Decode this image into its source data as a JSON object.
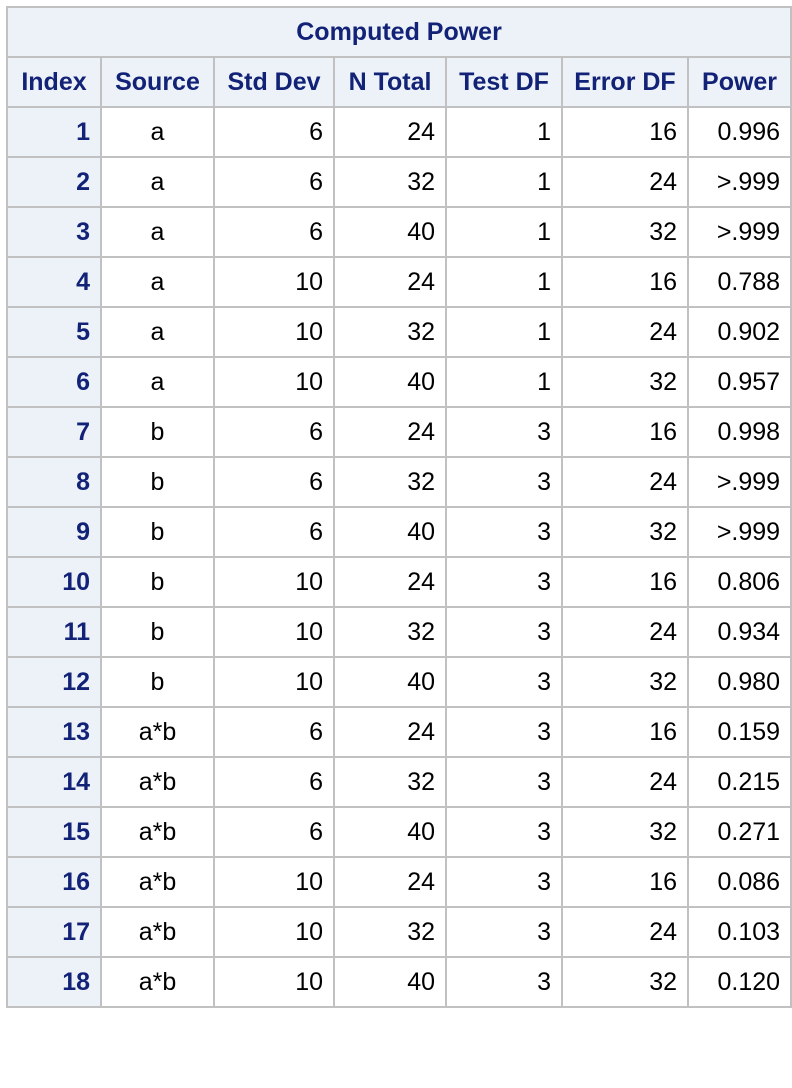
{
  "table": {
    "title": "Computed Power",
    "columns": [
      "Index",
      "Source",
      "Std Dev",
      "N Total",
      "Test DF",
      "Error DF",
      "Power"
    ],
    "rows": [
      [
        "1",
        "a",
        "6",
        "24",
        "1",
        "16",
        "0.996"
      ],
      [
        "2",
        "a",
        "6",
        "32",
        "1",
        "24",
        ">.999"
      ],
      [
        "3",
        "a",
        "6",
        "40",
        "1",
        "32",
        ">.999"
      ],
      [
        "4",
        "a",
        "10",
        "24",
        "1",
        "16",
        "0.788"
      ],
      [
        "5",
        "a",
        "10",
        "32",
        "1",
        "24",
        "0.902"
      ],
      [
        "6",
        "a",
        "10",
        "40",
        "1",
        "32",
        "0.957"
      ],
      [
        "7",
        "b",
        "6",
        "24",
        "3",
        "16",
        "0.998"
      ],
      [
        "8",
        "b",
        "6",
        "32",
        "3",
        "24",
        ">.999"
      ],
      [
        "9",
        "b",
        "6",
        "40",
        "3",
        "32",
        ">.999"
      ],
      [
        "10",
        "b",
        "10",
        "24",
        "3",
        "16",
        "0.806"
      ],
      [
        "11",
        "b",
        "10",
        "32",
        "3",
        "24",
        "0.934"
      ],
      [
        "12",
        "b",
        "10",
        "40",
        "3",
        "32",
        "0.980"
      ],
      [
        "13",
        "a*b",
        "6",
        "24",
        "3",
        "16",
        "0.159"
      ],
      [
        "14",
        "a*b",
        "6",
        "32",
        "3",
        "24",
        "0.215"
      ],
      [
        "15",
        "a*b",
        "6",
        "40",
        "3",
        "32",
        "0.271"
      ],
      [
        "16",
        "a*b",
        "10",
        "24",
        "3",
        "16",
        "0.086"
      ],
      [
        "17",
        "a*b",
        "10",
        "32",
        "3",
        "24",
        "0.103"
      ],
      [
        "18",
        "a*b",
        "10",
        "40",
        "3",
        "32",
        "0.120"
      ]
    ]
  },
  "colors": {
    "header_background": "#edf2f9",
    "header_text": "#112277",
    "border": "#c1c1c1",
    "body_text": "#000000"
  }
}
